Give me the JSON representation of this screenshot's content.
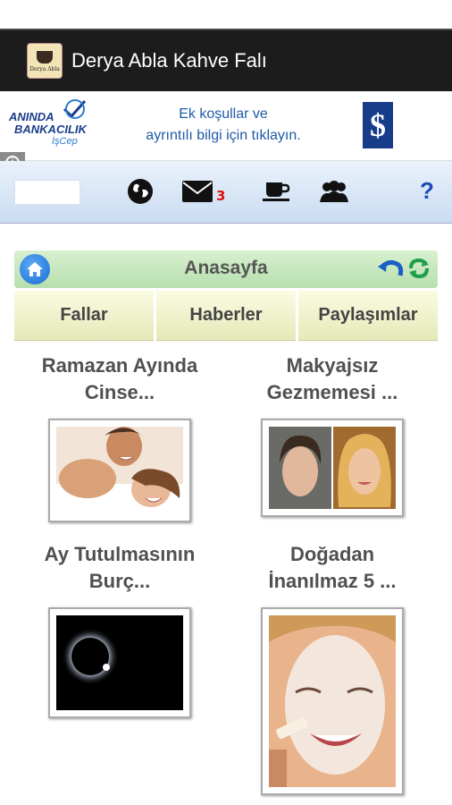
{
  "app": {
    "title": "Derya Abla Kahve Falı",
    "icon_label": "Derya Abla"
  },
  "ad": {
    "logo_line1": "ANINDA",
    "logo_line2": "BANKACILIK",
    "logo_sub": "İşCep",
    "text_line1": "Ek koşullar ve",
    "text_line2": "ayrıntılı bilgi için tıklayın.",
    "bank_glyph": "$",
    "info_glyph": "i"
  },
  "toolbar": {
    "icons": [
      "globe-icon",
      "mail-icon",
      "coffee-icon",
      "users-icon",
      "help-icon"
    ],
    "mail_badge": "3",
    "help_glyph": "?"
  },
  "nav": {
    "title": "Anasayfa"
  },
  "tabs": [
    "Fallar",
    "Haberler",
    "Paylaşımlar"
  ],
  "cards": [
    {
      "title_line1": "Ramazan Ayında",
      "title_line2": "Cinse...",
      "image": "couple-photo"
    },
    {
      "title_line1": "Makyajsız",
      "title_line2": "Gezmemesi ...",
      "image": "two-faces-photo"
    },
    {
      "title_line1": "Ay Tutulmasının",
      "title_line2": "Burç...",
      "image": "eclipse-photo"
    },
    {
      "title_line1": "Doğadan",
      "title_line2": "İnanılmaz 5 ...",
      "image": "face-mask-photo"
    }
  ],
  "colors": {
    "titlebar": "#1c1c1c",
    "toolbar": "#c9dcf2",
    "navbar": "#b6dfae",
    "tab": "#e5e9b8",
    "badge": "#e01010",
    "accent_blue": "#1b6cd4"
  }
}
